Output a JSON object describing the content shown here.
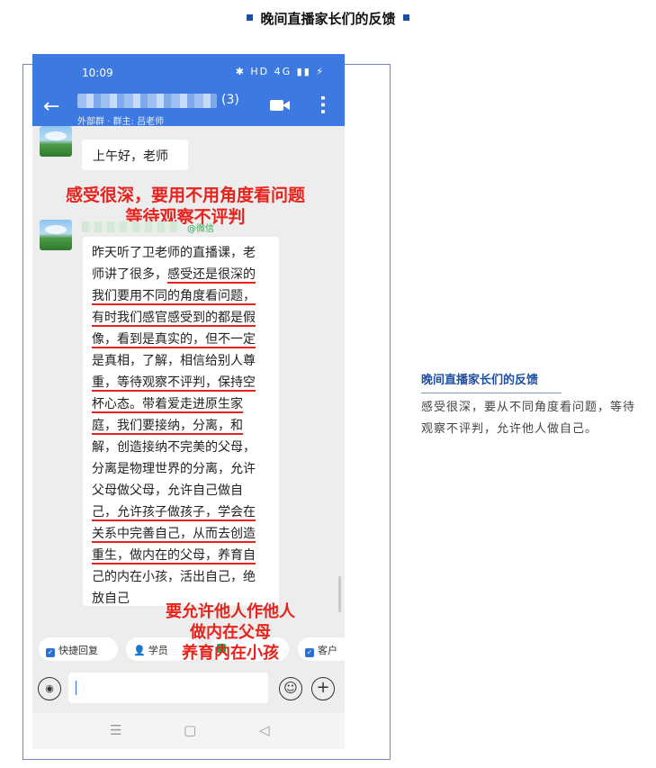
{
  "page": {
    "heading": "晚间直播家长们的反馈"
  },
  "phone": {
    "status_bar": {
      "time": "10:09",
      "icons": "✱ HD 4G ▮▮ ⚡"
    },
    "chat_header": {
      "member_count": "(3)",
      "subtitle": "外部群 · 群主: 吕老师",
      "back_icon": "arrow-left-icon",
      "video_icon": "video-call-icon",
      "more_icon": "more-vertical-icon"
    },
    "messages": [
      {
        "text": "上午好，老师"
      },
      {
        "source_tag": "@微信",
        "lines": [
          "昨天听了卫老师的直播课，老",
          "师讲了很多，感受还是很深的",
          "我们要用不同的角度看问题，",
          "有时我们感官感受到的都是假",
          "像，看到是真实的，但不一定",
          "是真相，了解，相信给别人尊",
          "重，等待观察不评判，保持空",
          "杯心态。带着爱走进原生家",
          "庭，我们要接纳，分离，和",
          "解，创造接纳不完美的父母，",
          "分离是物理世界的分离，允许",
          "父母做父母，允许自己做自",
          "己，允许孩子做孩子，学会在",
          "关系中完善自己，从而去创造",
          "重生，做内在的父母，养育自",
          "己的内在小孩，活出自己，绝",
          "放自己"
        ]
      }
    ],
    "annotations": {
      "top_1": "感受很深，要用不用角度看问题",
      "top_2": "等待观察不评判",
      "bottom_1": "要允许他人作他人",
      "bottom_2": "做内在父母",
      "bottom_3": "养育内在小孩"
    },
    "quick_actions": [
      {
        "label": "快捷回复"
      },
      {
        "label": "学员"
      },
      {
        "label": ""
      },
      {
        "label": "客户"
      }
    ],
    "input": {
      "placeholder": ""
    },
    "nav_keys": {
      "menu": "☰",
      "home": "▢",
      "back": "◁"
    }
  },
  "side_panel": {
    "title": "晚间直播家长们的反馈",
    "body": "感受很深，要从不同角度看问题，等待观察不评判，允许他人做自己。"
  },
  "colors": {
    "accent_blue": "#3c79e0",
    "heading_blue": "#1f4fa0",
    "annotation_red": "#e8231d",
    "wechat_green": "#2fae4f"
  }
}
